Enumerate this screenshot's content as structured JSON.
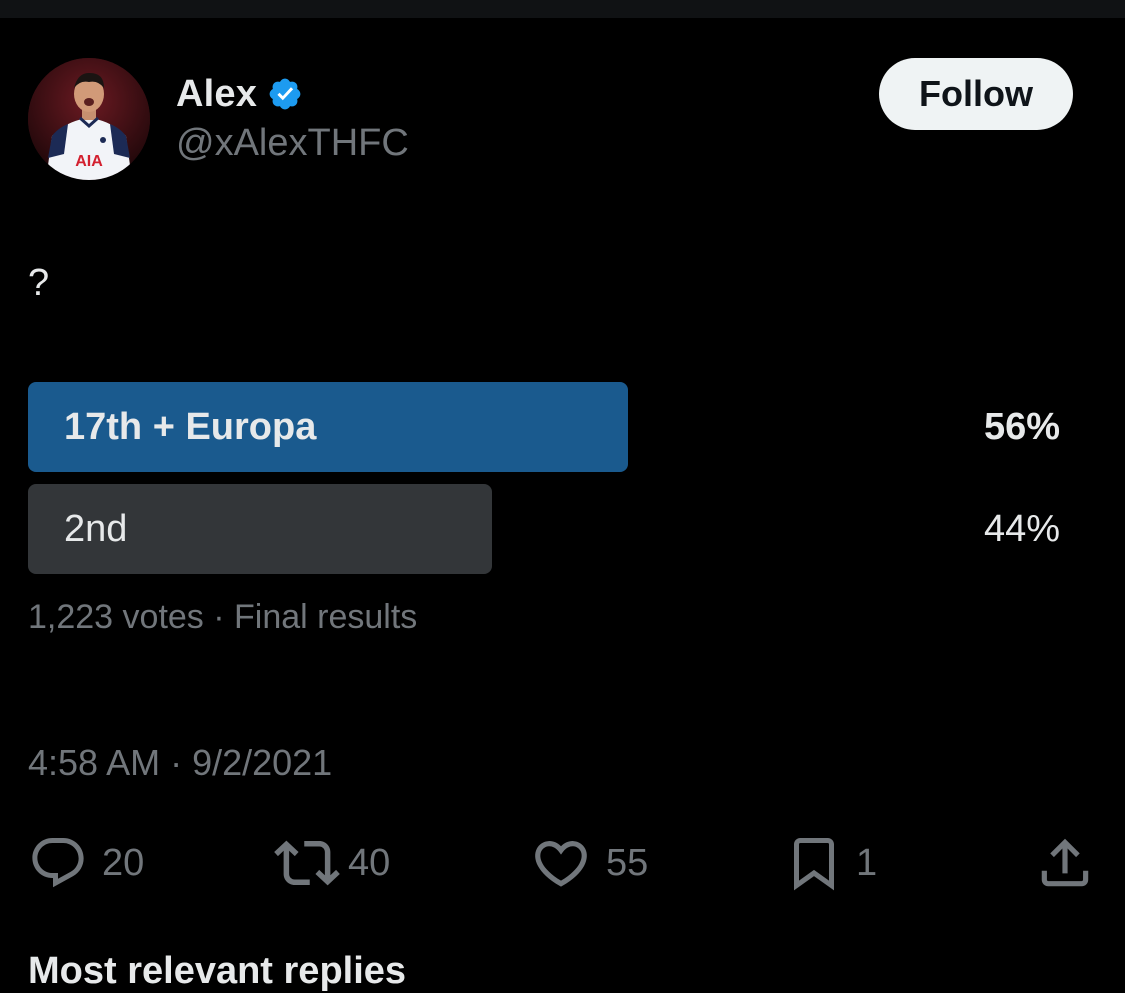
{
  "author": {
    "display_name": "Alex",
    "handle": "@xAlexTHFC",
    "verified": true,
    "avatar_jersey_text": "AIA"
  },
  "follow_label": "Follow",
  "tweet_text": "?",
  "poll": {
    "options": [
      {
        "label": "17th + Europa",
        "percent": "56%",
        "fraction": 0.56,
        "winner": true
      },
      {
        "label": "2nd",
        "percent": "44%",
        "fraction": 0.44,
        "winner": false
      }
    ],
    "meta": "1,223 votes · Final results"
  },
  "timestamp": "4:58 AM · 9/2/2021",
  "actions": {
    "replies": "20",
    "retweets": "40",
    "likes": "55",
    "bookmarks": "1"
  },
  "next_section_heading": "Most relevant replies",
  "colors": {
    "background": "#000000",
    "poll_winner": "#1a5a8e",
    "poll_other": "#333639",
    "verified_badge": "#1d9bf0",
    "secondary_text": "#71767b"
  }
}
